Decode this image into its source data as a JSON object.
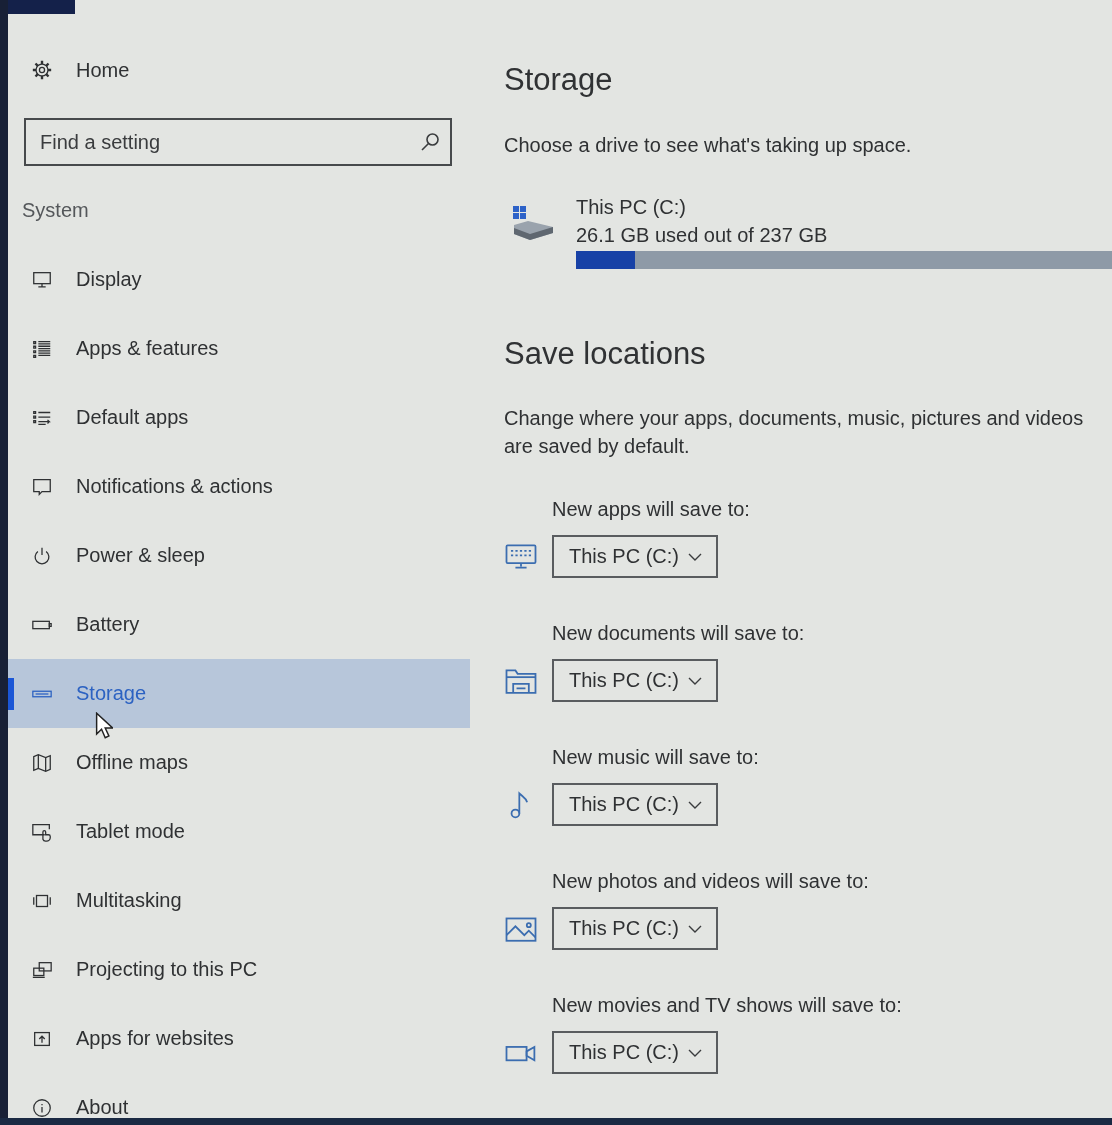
{
  "sidebar": {
    "home": {
      "label": "Home"
    },
    "search": {
      "placeholder": "Find a setting"
    },
    "section": "System",
    "items": [
      {
        "label": "Display",
        "selected": false
      },
      {
        "label": "Apps & features",
        "selected": false
      },
      {
        "label": "Default apps",
        "selected": false
      },
      {
        "label": "Notifications & actions",
        "selected": false
      },
      {
        "label": "Power & sleep",
        "selected": false
      },
      {
        "label": "Battery",
        "selected": false
      },
      {
        "label": "Storage",
        "selected": true
      },
      {
        "label": "Offline maps",
        "selected": false
      },
      {
        "label": "Tablet mode",
        "selected": false
      },
      {
        "label": "Multitasking",
        "selected": false
      },
      {
        "label": "Projecting to this PC",
        "selected": false
      },
      {
        "label": "Apps for websites",
        "selected": false
      },
      {
        "label": "About",
        "selected": false
      }
    ]
  },
  "storage": {
    "title": "Storage",
    "description": "Choose a drive to see what's taking up space.",
    "drives": [
      {
        "name": "This PC (C:)",
        "usage": "26.1 GB used out of 237 GB",
        "level": 0.11
      }
    ]
  },
  "save_locations": {
    "title": "Save locations",
    "description": "Change where your apps, documents, music, pictures and videos are saved by default.",
    "rows": [
      {
        "label": "New apps will save to:",
        "value": "This PC (C:)"
      },
      {
        "label": "New documents will save to:",
        "value": "This PC (C:)"
      },
      {
        "label": "New music will save to:",
        "value": "This PC (C:)"
      },
      {
        "label": "New photos and videos will save to:",
        "value": "This PC (C:)"
      },
      {
        "label": "New movies and TV shows will save to:",
        "value": "This PC (C:)"
      }
    ]
  }
}
